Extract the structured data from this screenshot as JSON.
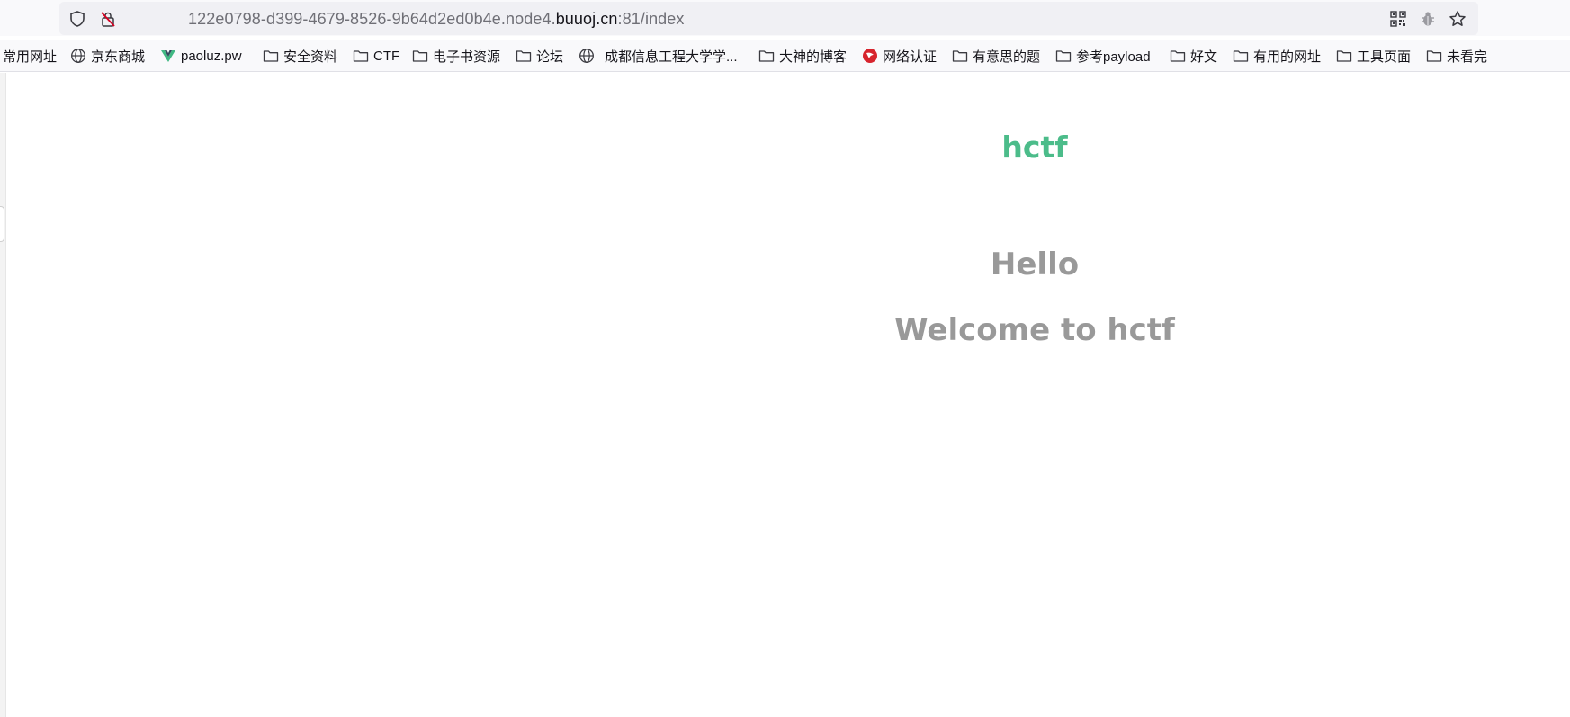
{
  "browser": {
    "url_prefix": "122e0798-d399-4679-8526-9b64d2ed0b4e.node4.",
    "url_domain": "buuoj.cn",
    "url_suffix": ":81/index"
  },
  "bookmarks": [
    {
      "label": "常用网址",
      "icon": "none"
    },
    {
      "label": "京东商城",
      "icon": "globe-icon"
    },
    {
      "label": "paoluz.pw",
      "icon": "vue-logo-icon"
    },
    {
      "label": "安全资料",
      "icon": "folder-icon"
    },
    {
      "label": "CTF",
      "icon": "folder-icon"
    },
    {
      "label": "电子书资源",
      "icon": "folder-icon"
    },
    {
      "label": "论坛",
      "icon": "folder-icon"
    },
    {
      "label": "成都信息工程大学学...",
      "icon": "globe-icon"
    },
    {
      "label": "大神的博客",
      "icon": "folder-icon"
    },
    {
      "label": "网络认证",
      "icon": "red-logo-icon"
    },
    {
      "label": "有意思的题",
      "icon": "folder-icon"
    },
    {
      "label": "参考payload",
      "icon": "folder-icon"
    },
    {
      "label": "好文",
      "icon": "folder-icon"
    },
    {
      "label": "有用的网址",
      "icon": "folder-icon"
    },
    {
      "label": "工具页面",
      "icon": "folder-icon"
    },
    {
      "label": "未看完",
      "icon": "folder-icon"
    }
  ],
  "page": {
    "brand": "hctf",
    "heading1": "Hello",
    "heading2": "Welcome to hctf"
  },
  "colors": {
    "brand": "#4cbc8a",
    "heading": "#999999"
  }
}
